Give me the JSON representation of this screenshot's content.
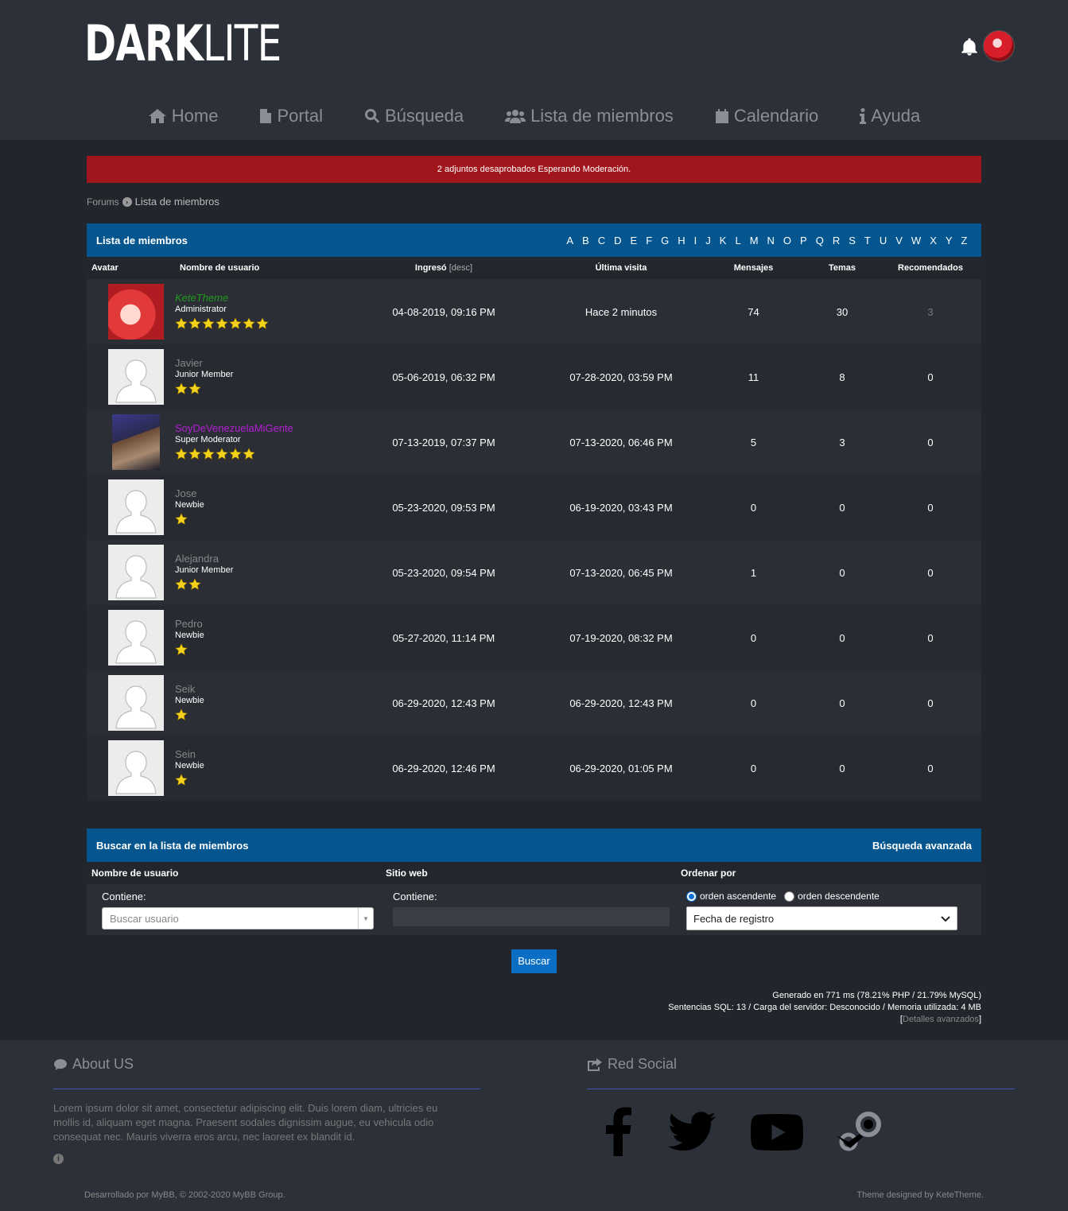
{
  "header": {
    "logo_bold": "DARK",
    "logo_light": "LITE"
  },
  "nav": [
    {
      "label": "Home",
      "icon": "home-icon"
    },
    {
      "label": "Portal",
      "icon": "file-icon"
    },
    {
      "label": "Búsqueda",
      "icon": "search-icon"
    },
    {
      "label": "Lista de miembros",
      "icon": "users-icon"
    },
    {
      "label": "Calendario",
      "icon": "calendar-icon"
    },
    {
      "label": "Ayuda",
      "icon": "info-icon"
    }
  ],
  "alert": {
    "text": "2 adjuntos desaprobados",
    "link": "Esperando Moderación."
  },
  "breadcrumb": {
    "root": "Forums",
    "current": "Lista de miembros"
  },
  "members_table": {
    "title": "Lista de miembros",
    "letters": [
      "A",
      "B",
      "C",
      "D",
      "E",
      "F",
      "G",
      "H",
      "I",
      "J",
      "K",
      "L",
      "M",
      "N",
      "O",
      "P",
      "Q",
      "R",
      "S",
      "T",
      "U",
      "V",
      "W",
      "X",
      "Y",
      "Z"
    ],
    "columns": {
      "avatar": "Avatar",
      "username": "Nombre de usuario",
      "joined": "Ingresó",
      "joined_sort": "[desc]",
      "last_visit": "Última visita",
      "posts": "Mensajes",
      "threads": "Temas",
      "recommended": "Recomendados"
    },
    "rows": [
      {
        "name": "KeteTheme",
        "role": "Administrator",
        "stars": 7,
        "joined": "04-08-2019, 09:16 PM",
        "last": "Hace 2 minutos",
        "posts": "74",
        "threads": "30",
        "rec": "3"
      },
      {
        "name": "Javier",
        "role": "Junior Member",
        "stars": 2,
        "joined": "05-06-2019, 06:32 PM",
        "last": "07-28-2020, 03:59 PM",
        "posts": "11",
        "threads": "8",
        "rec": "0"
      },
      {
        "name": "SoyDeVenezuelaMiGente",
        "role": "Super Moderator",
        "stars": 6,
        "joined": "07-13-2019, 07:37 PM",
        "last": "07-13-2020, 06:46 PM",
        "posts": "5",
        "threads": "3",
        "rec": "0"
      },
      {
        "name": "Jose",
        "role": "Newbie",
        "stars": 1,
        "joined": "05-23-2020, 09:53 PM",
        "last": "06-19-2020, 03:43 PM",
        "posts": "0",
        "threads": "0",
        "rec": "0"
      },
      {
        "name": "Alejandra",
        "role": "Junior Member",
        "stars": 2,
        "joined": "05-23-2020, 09:54 PM",
        "last": "07-13-2020, 06:45 PM",
        "posts": "1",
        "threads": "0",
        "rec": "0"
      },
      {
        "name": "Pedro",
        "role": "Newbie",
        "stars": 1,
        "joined": "05-27-2020, 11:14 PM",
        "last": "07-19-2020, 08:32 PM",
        "posts": "0",
        "threads": "0",
        "rec": "0"
      },
      {
        "name": "Seik",
        "role": "Newbie",
        "stars": 1,
        "joined": "06-29-2020, 12:43 PM",
        "last": "06-29-2020, 12:43 PM",
        "posts": "0",
        "threads": "0",
        "rec": "0"
      },
      {
        "name": "Sein",
        "role": "Newbie",
        "stars": 1,
        "joined": "06-29-2020, 12:46 PM",
        "last": "06-29-2020, 01:05 PM",
        "posts": "0",
        "threads": "0",
        "rec": "0"
      }
    ]
  },
  "search": {
    "title": "Buscar en la lista de miembros",
    "advanced": "Búsqueda avanzada",
    "col_username": "Nombre de usuario",
    "col_website": "Sitio web",
    "col_order": "Ordenar por",
    "contains_label": "Contiene:",
    "user_placeholder": "Buscar usuario",
    "order_asc": "orden ascendente",
    "order_desc": "orden descendente",
    "sort_selected": "Fecha de registro",
    "button": "Buscar"
  },
  "stats": {
    "line1": "Generado en 771 ms (78.21% PHP / 21.79% MySQL)",
    "line2": "Sentencias SQL: 13 / Carga del servidor: Desconocido / Memoria utilizada: 4 MB",
    "adv_open": "[",
    "adv_link": "Detalles avanzados",
    "adv_close": "]"
  },
  "footer": {
    "about_title": "About US",
    "about_text": "Lorem ipsum dolor sit amet, consectetur adipiscing elit. Duis lorem diam, ultricies eu mollis id, aliquam eget magna. Praesent sodales dignissim augue, eu vehicula odio consequat nec. Mauris viverra eros arcu, nec laoreet ex blandit id.",
    "social_title": "Red Social",
    "social": [
      "facebook-icon",
      "twitter-icon",
      "youtube-icon",
      "steam-icon"
    ],
    "powered": "Desarrollado por MyBB, © 2002-2020 MyBB Group.",
    "theme": "Theme designed by KeteTheme."
  },
  "colors": {
    "accent": "#05568f",
    "alert": "#a1161c",
    "admin": "#1f9c1f",
    "super_mod": "#b51fd6",
    "star": "#f2d21b"
  }
}
